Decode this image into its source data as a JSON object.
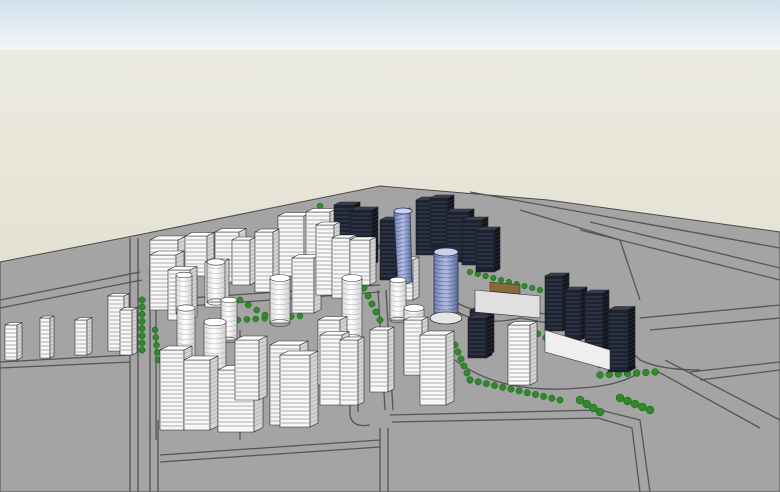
{
  "scene": {
    "kind": "3d-city-massing-model",
    "colors": {
      "sky_top": "#cfe1ea",
      "sky_bottom": "#f4f7f8",
      "horizon_ground": "#e9e6d8",
      "far_ground": "#dedac8",
      "site": "#a4a4a4",
      "road_line": "#5c5c5c",
      "building_light": "#f7f7f7",
      "building_shade": "#d4d4d4",
      "building_dark": "#1d2230",
      "glass_tower": "#8f9ec9",
      "tree": "#2f8a2a"
    }
  }
}
